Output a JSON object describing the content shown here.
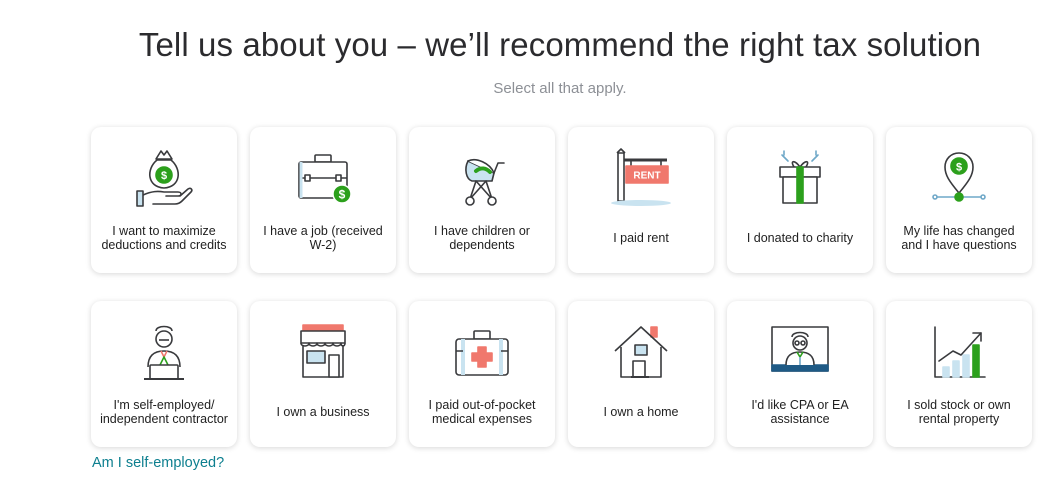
{
  "header": {
    "title": "Tell us about you – we’ll recommend the right tax solution",
    "subtitle": "Select all that apply."
  },
  "cards": [
    {
      "label": "I want to maximize deductions and credits",
      "icon": "money-bag-hand-icon"
    },
    {
      "label": "I have a job (received W-2)",
      "icon": "briefcase-icon"
    },
    {
      "label": "I have children or dependents",
      "icon": "stroller-icon"
    },
    {
      "label": "I paid rent",
      "icon": "rent-sign-icon",
      "sign_text": "RENT"
    },
    {
      "label": "I donated to charity",
      "icon": "gift-icon"
    },
    {
      "label": "My life has changed and I have questions",
      "icon": "location-pin-dollar-icon"
    },
    {
      "label": "I'm self-employed/ independent contractor",
      "icon": "person-laptop-icon"
    },
    {
      "label": "I own a business",
      "icon": "storefront-icon"
    },
    {
      "label": "I paid out-of-pocket medical expenses",
      "icon": "medical-kit-icon"
    },
    {
      "label": "I own a home",
      "icon": "house-icon"
    },
    {
      "label": "I'd like CPA or EA assistance",
      "icon": "expert-monitor-icon"
    },
    {
      "label": "I sold stock or own rental property",
      "icon": "growth-chart-icon"
    }
  ],
  "help_link": "Am I self-employed?",
  "colors": {
    "accent_green": "#2ca01c",
    "accent_red": "#f0786d",
    "link": "#0d7f8f",
    "icon_stroke": "#393a3d",
    "light_blue": "#c9e3f0"
  }
}
